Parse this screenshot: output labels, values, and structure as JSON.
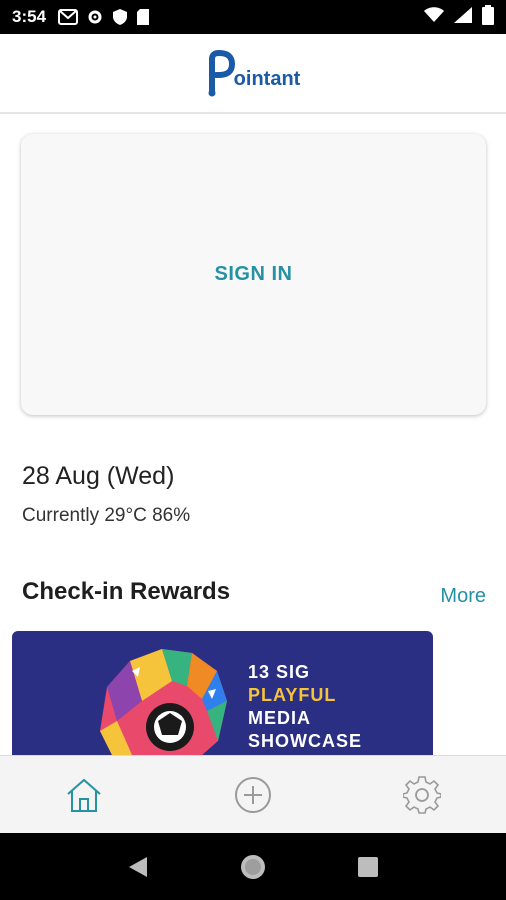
{
  "status_bar": {
    "time": "3:54",
    "icons": [
      "gmail-icon",
      "settings-icon",
      "shield-icon",
      "sd-card-icon"
    ],
    "right_icons": [
      "wifi-icon",
      "signal-icon",
      "battery-icon"
    ]
  },
  "app_bar": {
    "logo_text": "ointant"
  },
  "signin": {
    "label": "SIGN IN"
  },
  "info": {
    "date": "28 Aug (Wed)",
    "weather": "Currently 29°C 86%"
  },
  "rewards": {
    "title": "Check-in Rewards",
    "more_label": "More",
    "card_lines": [
      "13 SIG",
      "PLAYFUL",
      "MEDIA",
      "SHOWCASE"
    ]
  },
  "bottom_nav": {
    "items": [
      "home-icon",
      "add-icon",
      "settings-icon"
    ],
    "accent": "#2592a3"
  },
  "colors": {
    "accent": "#2592a3",
    "brand": "#1a5aa6",
    "card_bg": "#2b2f84"
  }
}
